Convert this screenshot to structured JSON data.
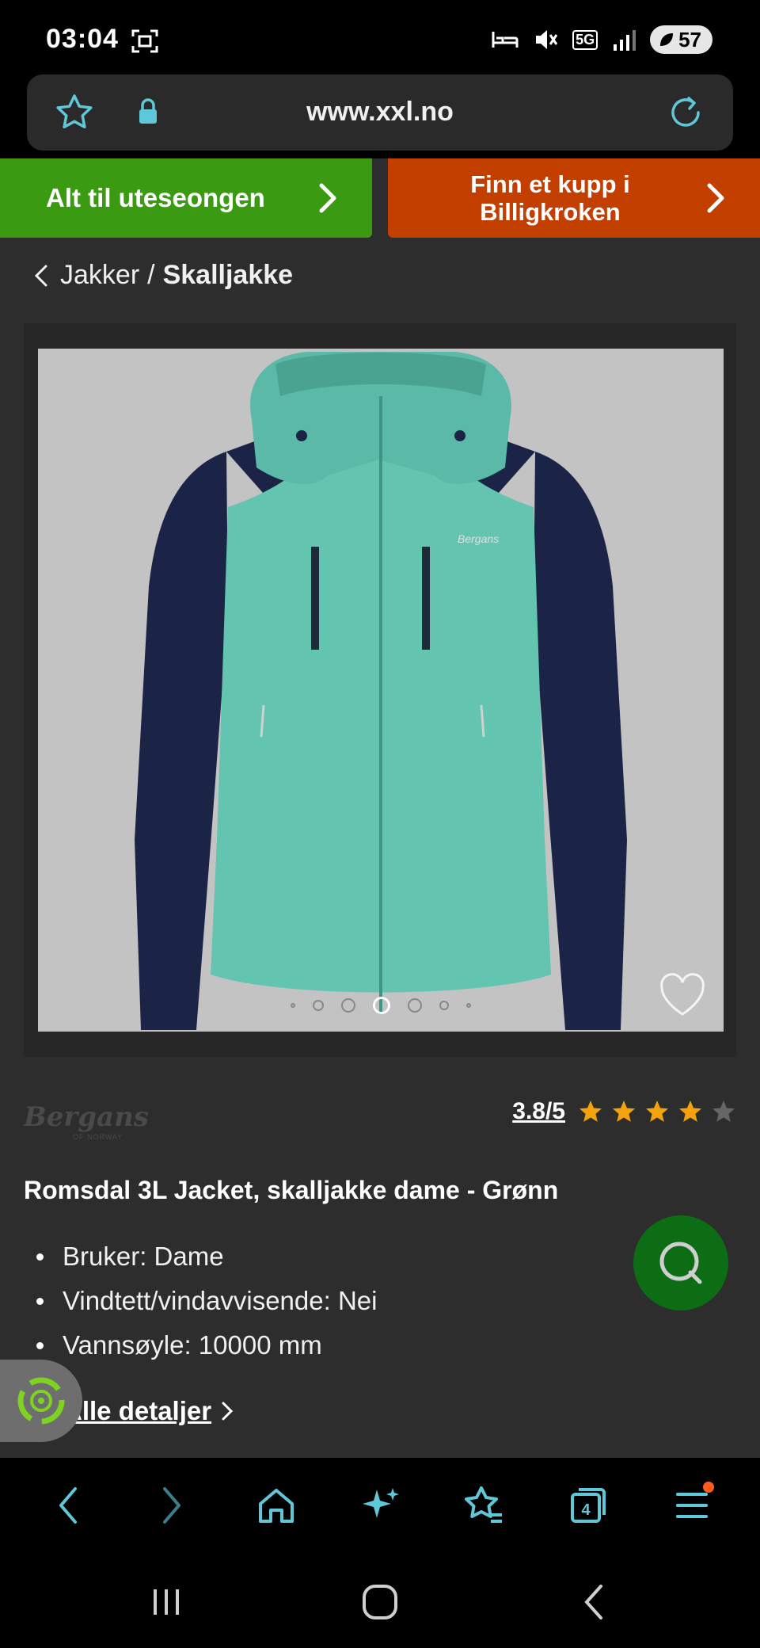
{
  "status_bar": {
    "time": "03:04",
    "battery": "57",
    "network": "5G"
  },
  "url_bar": {
    "url": "www.xxl.no"
  },
  "banners": {
    "left": "Alt til uteseongen",
    "right_line1": "Finn et kupp i",
    "right_line2": "Billigkroken"
  },
  "breadcrumb": {
    "parent": "Jakker",
    "separator": "/",
    "current": "Skalljakke"
  },
  "gallery": {
    "slide_count": 7,
    "active_slide": 4
  },
  "brand": {
    "name": "Bergans",
    "sub": "OF NORWAY"
  },
  "rating": {
    "text": "3.8/5",
    "value": 3.8,
    "max": 5
  },
  "product": {
    "title": "Romsdal 3L Jacket, skalljakke dame - Grønn",
    "specs": [
      "Bruker: Dame",
      "Vindtett/vindavvisende: Nei",
      "Vannsøyle: 10000 mm"
    ],
    "details_link": "Alle detaljer"
  },
  "toolbar": {
    "tabs_count": "4"
  },
  "colors": {
    "accent": "#5ec8d8",
    "green_banner": "#3a9b12",
    "orange_banner": "#c33f00",
    "star": "#f5a30a",
    "chat_fab": "#0c6d14",
    "jacket_teal": "#63c4b0",
    "jacket_navy": "#1b2447"
  }
}
